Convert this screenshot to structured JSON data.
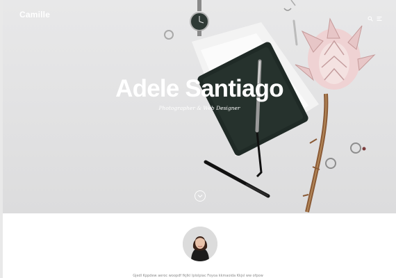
{
  "brand": {
    "name": "Camille"
  },
  "header_icons": [
    "search-icon",
    "menu-icon"
  ],
  "hero": {
    "title": "Adele Santiago",
    "subtitle": "Photographer & Web Designer",
    "scroll_icon": "chevron-down-icon"
  },
  "profile": {
    "avatar_icon": "profile-photo",
    "intro_text": "Gjedl Kppdew aeroc woopdf fkjlkl lplolpiac Foyoa kkmaoida Kkjsl ww ofpow"
  },
  "colors": {
    "hero_background": "#e3e3e4",
    "title_text": "#ffffff",
    "notebook": "#1f2a26"
  }
}
